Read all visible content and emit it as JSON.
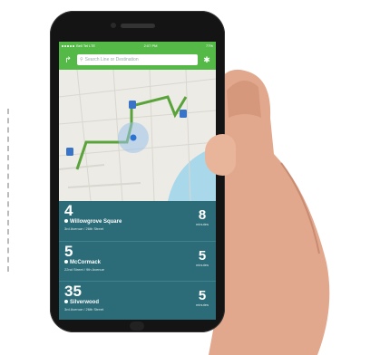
{
  "status_bar": {
    "carrier": "Bell Tel LTE",
    "time": "2:07 PM",
    "battery": "77%"
  },
  "search": {
    "placeholder": "Search Line or Destination"
  },
  "header_icons": {
    "left": "directions-icon",
    "right": "settings-icon"
  },
  "arrivals": [
    {
      "route": "4",
      "stop": "Willowgrove Square",
      "streets": "3rd Avenue / 26th Street",
      "minutes": "8",
      "unit": "minutes"
    },
    {
      "route": "5",
      "stop": "McCormack",
      "streets": "22nd Street / 9th Avenue",
      "minutes": "5",
      "unit": "minutes"
    },
    {
      "route": "35",
      "stop": "Silverwood",
      "streets": "3rd Avenue / 26th Street",
      "minutes": "5",
      "unit": "minutes"
    }
  ],
  "colors": {
    "brand_green": "#55b948",
    "list_teal": "#2b6c78",
    "map_bg": "#ecebe6",
    "route_line": "#5aa33a",
    "stop_pin": "#3a74c9"
  }
}
